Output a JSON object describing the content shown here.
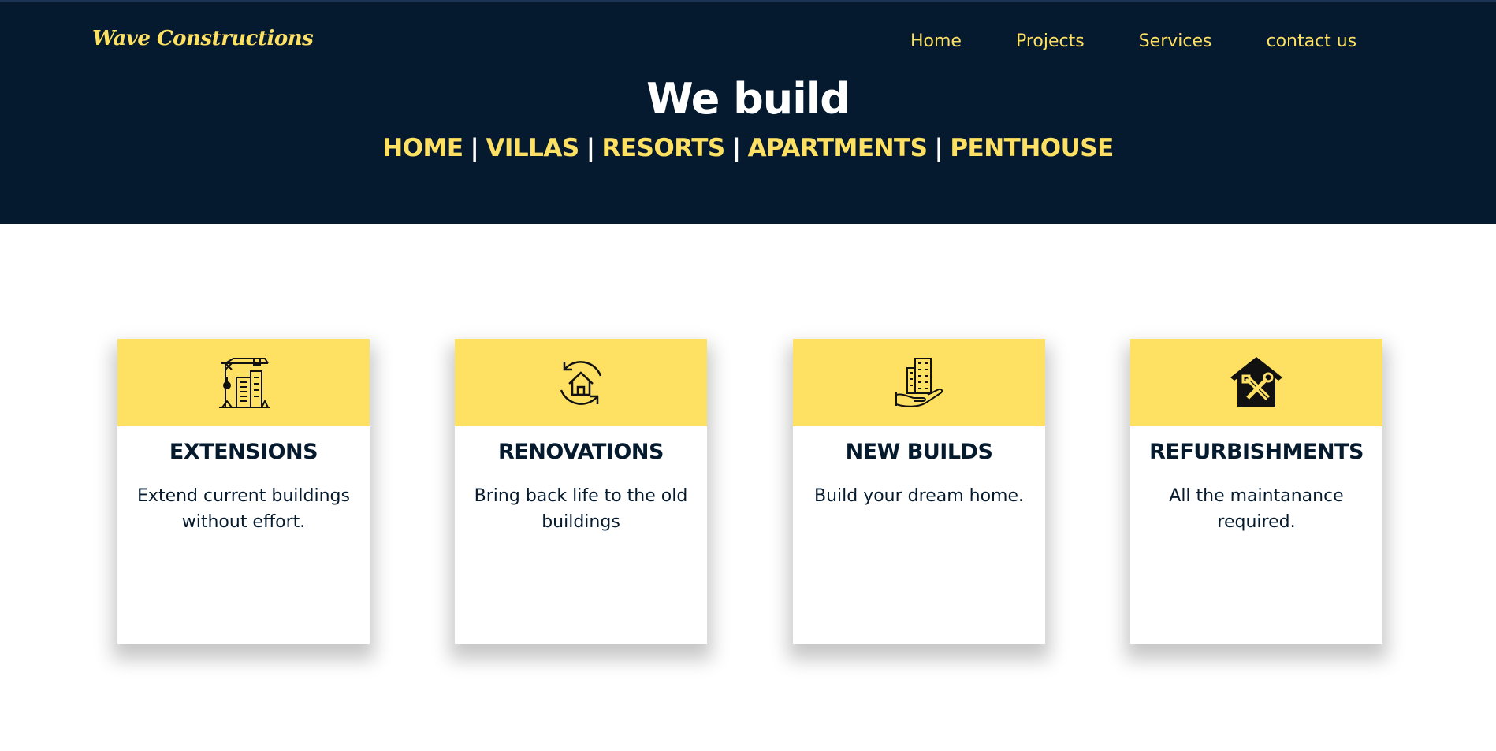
{
  "brand": {
    "logo": "Wave Constructions",
    "accent_color": "#fee063",
    "hero_bg": "#051a2e"
  },
  "nav": {
    "items": [
      {
        "label": "Home"
      },
      {
        "label": "Projects"
      },
      {
        "label": "Services"
      },
      {
        "label": "contact us"
      }
    ]
  },
  "hero": {
    "title": "We build",
    "types": [
      "HOME",
      "VILLAS",
      "RESORTS",
      "APARTMENTS",
      "PENTHOUSE"
    ],
    "separator": "|"
  },
  "services": [
    {
      "icon": "crane-building-icon",
      "title": "EXTENSIONS",
      "text": "Extend current buildings without effort."
    },
    {
      "icon": "house-refresh-icon",
      "title": "RENOVATIONS",
      "text": "Bring back life to the old buildings"
    },
    {
      "icon": "building-in-hand-icon",
      "title": "NEW BUILDS",
      "text": "Build your dream home."
    },
    {
      "icon": "house-tools-icon",
      "title": "REFURBISHMENTS",
      "text": "All the maintanance required."
    }
  ]
}
